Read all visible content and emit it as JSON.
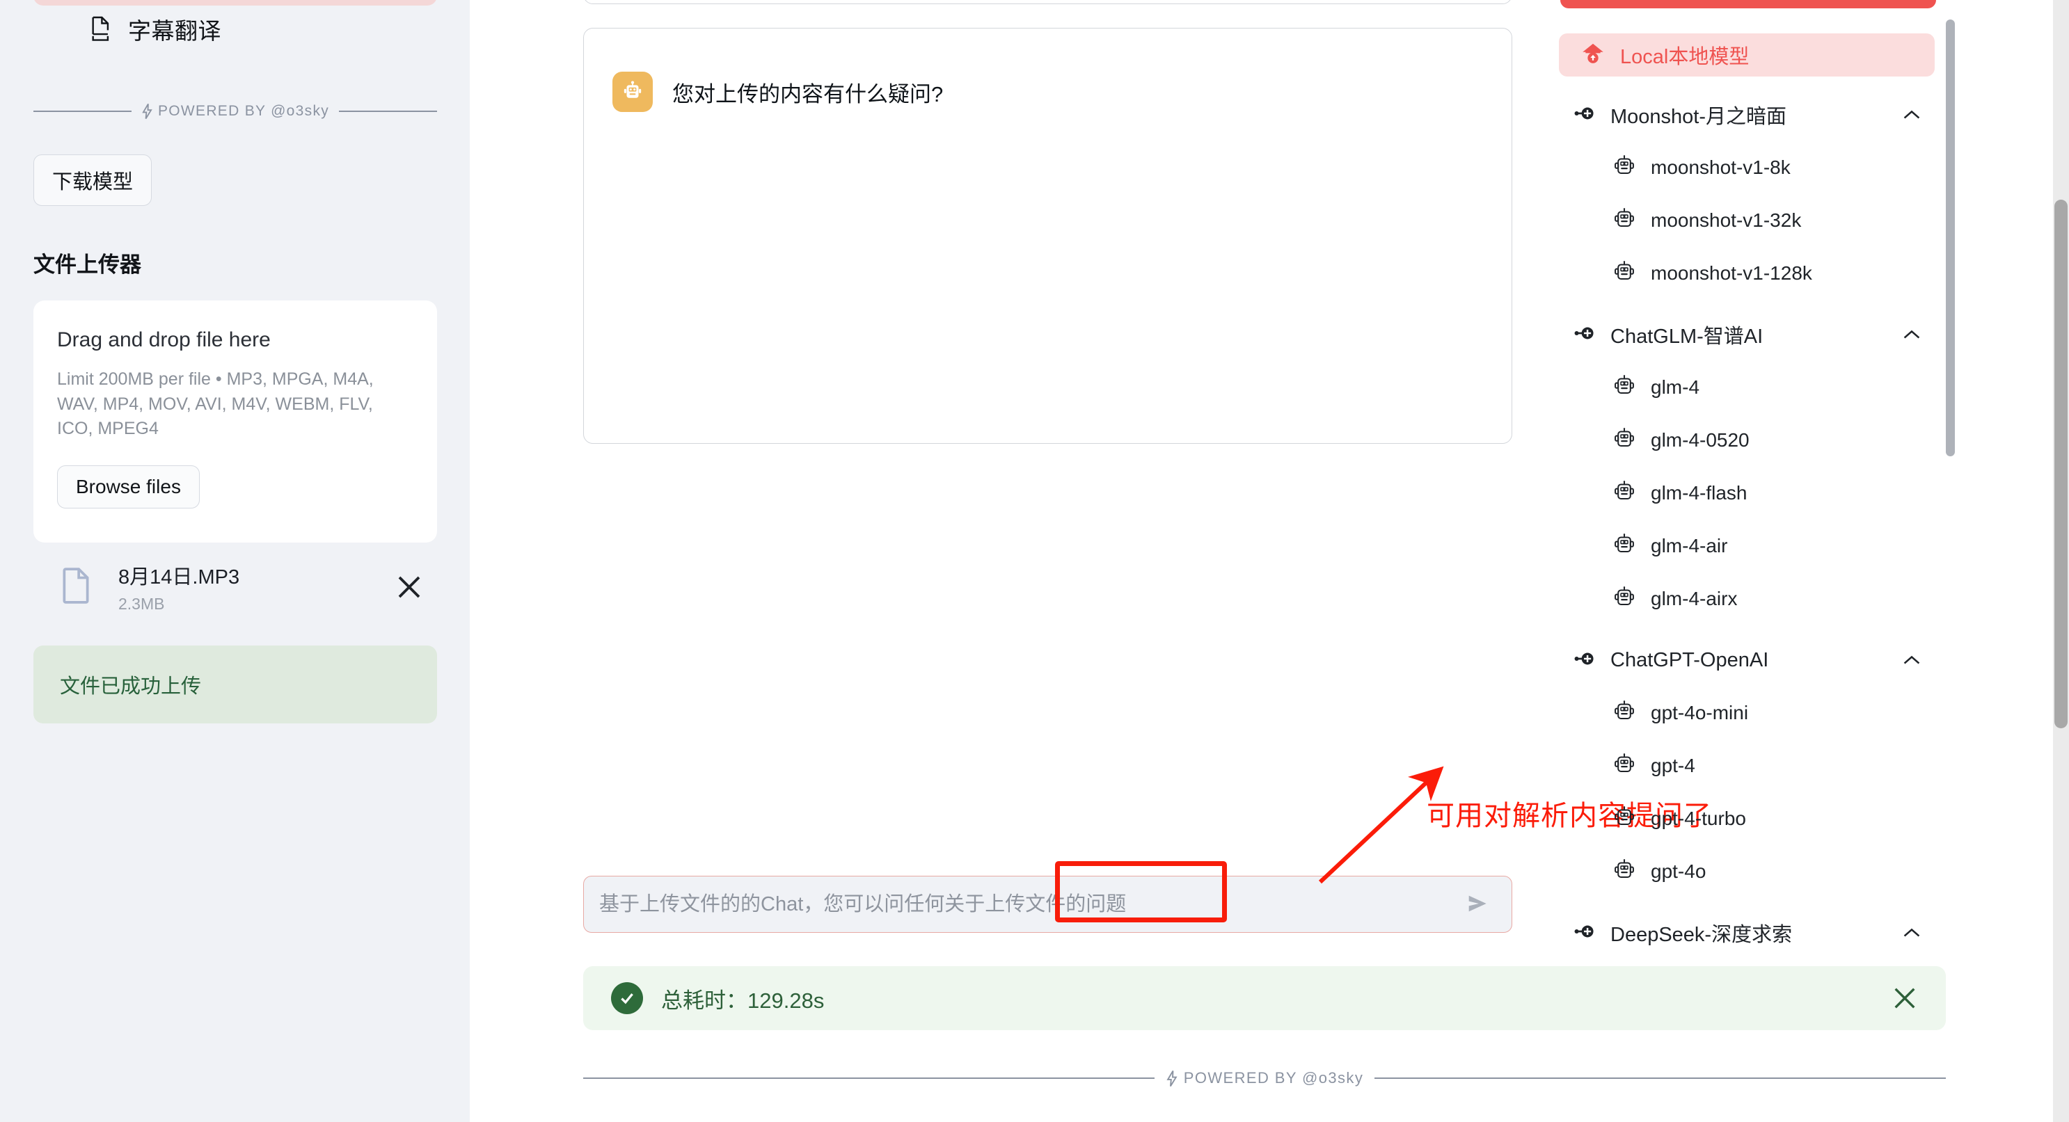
{
  "sidebar": {
    "nav_item": {
      "label": "字幕翻译",
      "icon": "document-export-icon"
    },
    "powered_by": "POWERED BY @o3sky",
    "download_model_button": "下载模型",
    "section_title": "文件上传器",
    "dropzone": {
      "title": "Drag and drop file here",
      "subtitle": "Limit 200MB per file • MP3, MPGA, M4A, WAV, MP4, MOV, AVI, M4V, WEBM, FLV, ICO, MPEG4",
      "browse_button": "Browse files"
    },
    "uploaded_file": {
      "name": "8月14日.MP3",
      "size": "2.3MB",
      "remove_icon": "close-icon"
    },
    "upload_status": "文件已成功上传"
  },
  "chat": {
    "bot_message": "您对上传的内容有什么疑问?",
    "bot_avatar_icon": "robot-icon",
    "input_placeholder": "基于上传文件的的Chat，您可以问任何关于上传文件的问题",
    "input_value": "",
    "send_icon": "send-arrow-icon"
  },
  "annotation": {
    "text": "可用对解析内容提问了",
    "color": "#fb1c09"
  },
  "status": {
    "text": "总耗时：129.28s",
    "icon": "check-circle-icon",
    "close_icon": "close-icon",
    "color": "#2d6039"
  },
  "footer": {
    "powered_by": "POWERED BY @o3sky"
  },
  "model_panel": {
    "active_item": {
      "label": "Local本地模型",
      "icon": "home-upload-icon",
      "color": "#ef5350"
    },
    "groups": [
      {
        "label": "Moonshot-月之暗面",
        "icon": "plug-icon",
        "expanded": true,
        "models": [
          "moonshot-v1-8k",
          "moonshot-v1-32k",
          "moonshot-v1-128k"
        ]
      },
      {
        "label": "ChatGLM-智谱AI",
        "icon": "plug-icon",
        "expanded": true,
        "models": [
          "glm-4",
          "glm-4-0520",
          "glm-4-flash",
          "glm-4-air",
          "glm-4-airx"
        ]
      },
      {
        "label": "ChatGPT-OpenAI",
        "icon": "plug-icon",
        "expanded": true,
        "models": [
          "gpt-4o-mini",
          "gpt-4",
          "gpt-4-turbo",
          "gpt-4o"
        ]
      },
      {
        "label": "DeepSeek-深度求索",
        "icon": "plug-icon",
        "expanded": true,
        "models": []
      }
    ]
  }
}
